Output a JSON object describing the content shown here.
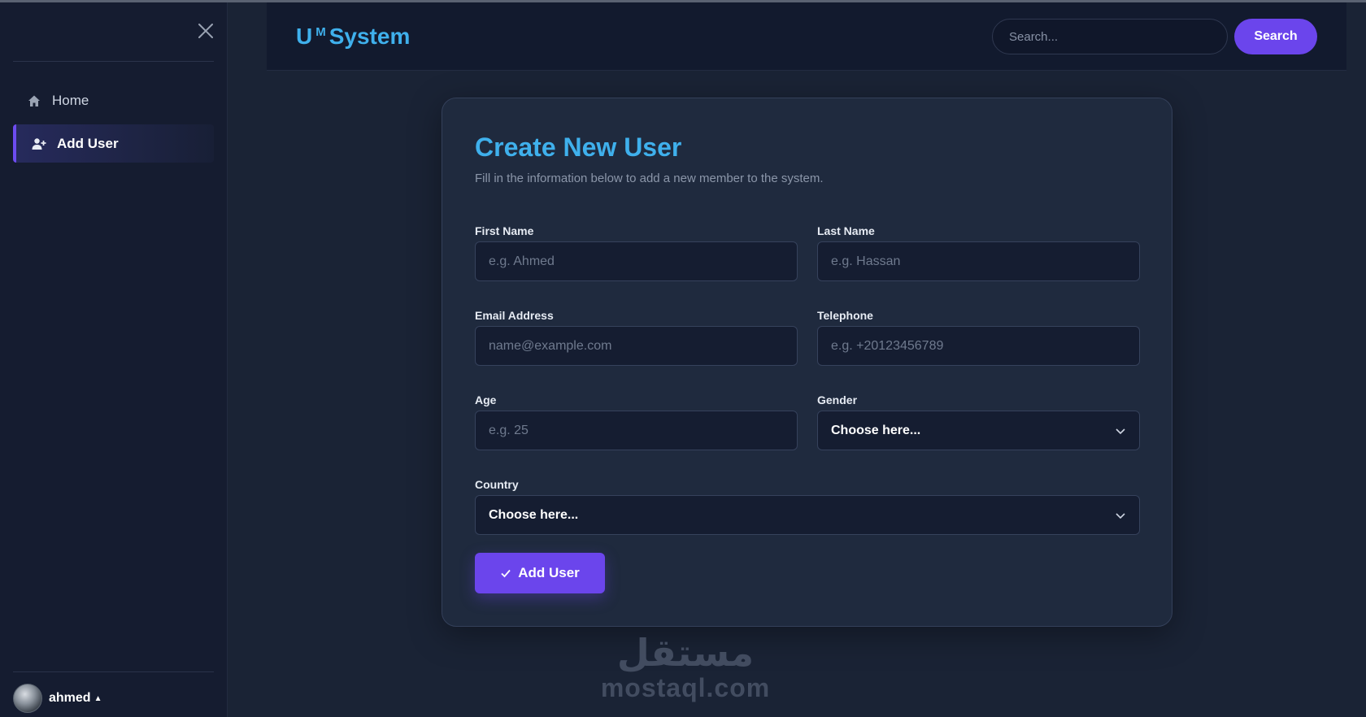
{
  "sidebar": {
    "items": [
      {
        "label": "Home",
        "icon": "home-icon",
        "active": false
      },
      {
        "label": "Add User",
        "icon": "user-plus-icon",
        "active": true
      }
    ],
    "user": {
      "name": "ahmed"
    }
  },
  "header": {
    "brand_main": "U",
    "brand_sup": "M",
    "brand_rest": "System",
    "search_placeholder": "Search...",
    "search_button": "Search"
  },
  "form": {
    "title": "Create New User",
    "subtitle": "Fill in the information below to add a new member to the system.",
    "first_name": {
      "label": "First Name",
      "placeholder": "e.g. Ahmed"
    },
    "last_name": {
      "label": "Last Name",
      "placeholder": "e.g. Hassan"
    },
    "email": {
      "label": "Email Address",
      "placeholder": "name@example.com"
    },
    "telephone": {
      "label": "Telephone",
      "placeholder": "e.g. +20123456789"
    },
    "age": {
      "label": "Age",
      "placeholder": "e.g. 25"
    },
    "gender": {
      "label": "Gender",
      "value": "Choose here..."
    },
    "country": {
      "label": "Country",
      "value": "Choose here..."
    },
    "submit": "Add User"
  },
  "watermark": {
    "logo": "مستقل",
    "text": "mostaql.com"
  },
  "colors": {
    "accent": "#6b45ec",
    "brand": "#3fb0ec",
    "background": "#1a2335"
  }
}
